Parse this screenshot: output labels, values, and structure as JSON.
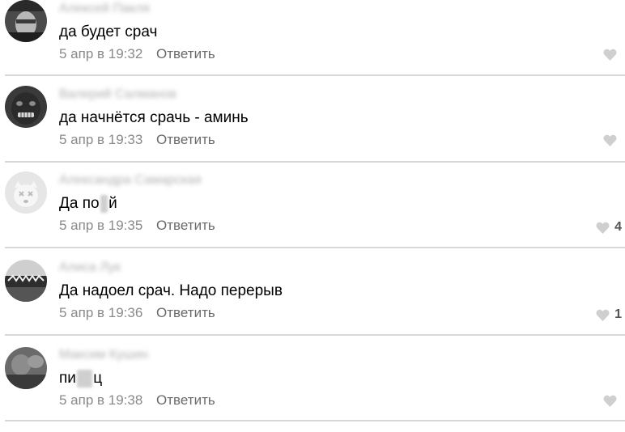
{
  "comments": [
    {
      "author": "Алексей Пакля",
      "text": "да будет срач",
      "time": "5 апр в 19:32",
      "reply": "Ответить",
      "likes": ""
    },
    {
      "author": "Валерий Салманов",
      "text": "да начнётся срачь - аминь",
      "time": "5 апр в 19:33",
      "reply": "Ответить",
      "likes": ""
    },
    {
      "author": "Александра Самарская",
      "text_a": "Да по",
      "text_censor": "х",
      "text_b": "й",
      "time": "5 апр в 19:35",
      "reply": "Ответить",
      "likes": "4"
    },
    {
      "author": "Алиса Лук",
      "text": "Да надоел срач. Надо перерыв",
      "time": "5 апр в 19:36",
      "reply": "Ответить",
      "likes": "1"
    },
    {
      "author": "Максим Кушин",
      "text_a": "пи",
      "text_censor": "зд",
      "text_b": "ц",
      "time": "5 апр в 19:38",
      "reply": "Ответить",
      "likes": ""
    }
  ],
  "icons": {
    "like": "heart-icon"
  },
  "colors": {
    "heart": "#cfcfcf",
    "divider": "#d8d8d8",
    "meta": "#8a8a8a"
  }
}
